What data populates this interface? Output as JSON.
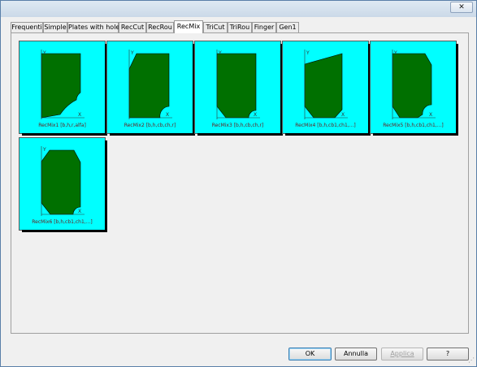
{
  "titlebar": {
    "close_glyph": "✕"
  },
  "tabs": [
    {
      "label": "Frequenti",
      "selected": false
    },
    {
      "label": "Simple",
      "selected": false
    },
    {
      "label": "Plates with holes",
      "selected": false
    },
    {
      "label": "RecCut",
      "selected": false
    },
    {
      "label": "RecRou",
      "selected": false
    },
    {
      "label": "RecMix",
      "selected": true
    },
    {
      "label": "TriCut",
      "selected": false
    },
    {
      "label": "TriRou",
      "selected": false
    },
    {
      "label": "Finger",
      "selected": false
    },
    {
      "label": "Gen1",
      "selected": false
    }
  ],
  "tiles": [
    {
      "label": "RecMix1 [b,h,r,alfa]",
      "axis_y": "Y",
      "axis_x": "X"
    },
    {
      "label": "RecMix2 [b,h,cb,ch,r]",
      "axis_y": "Y",
      "axis_x": "X"
    },
    {
      "label": "RecMix3 [b,h,cb,ch,r]",
      "axis_y": "Y",
      "axis_x": "X"
    },
    {
      "label": "RecMix4 [b,h,cb1,ch1,...]",
      "axis_y": "Y",
      "axis_x": "X"
    },
    {
      "label": "RecMix5 [b,h,cb1,ch1,...]",
      "axis_y": "Y",
      "axis_x": "X"
    },
    {
      "label": "RecMix6 [b,h,cb1,ch1,...]",
      "axis_y": "Y",
      "axis_x": "X"
    }
  ],
  "buttons": {
    "ok": "OK",
    "cancel": "Annulla",
    "apply": "Applica",
    "help": "?"
  },
  "colors": {
    "tile_background": "#00ffff",
    "shape_fill": "#007000",
    "label_text": "#6a1a1a"
  }
}
